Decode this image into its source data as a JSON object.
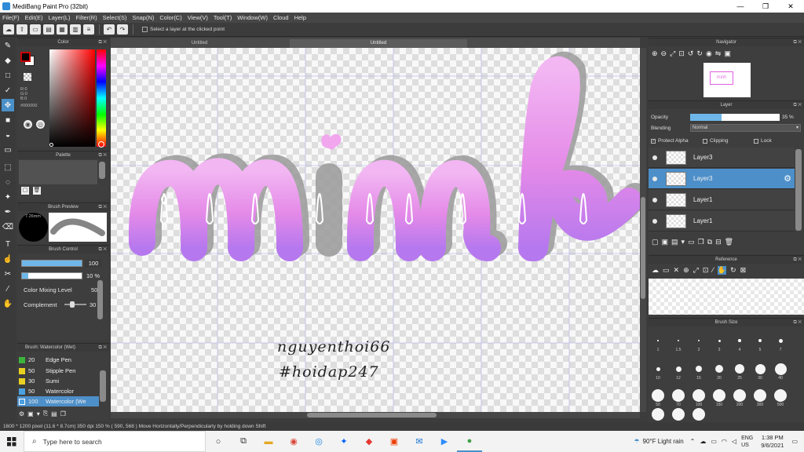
{
  "window": {
    "title": "MediBang Paint Pro (32bit)",
    "minimize": "—",
    "maximize": "❐",
    "close": "✕"
  },
  "menu": [
    "File(F)",
    "Edit(E)",
    "Layer(L)",
    "Filter(R)",
    "Select(S)",
    "Snap(N)",
    "Color(C)",
    "View(V)",
    "Tool(T)",
    "Window(W)",
    "Cloud",
    "Help"
  ],
  "toolbar": {
    "select_layer_label": "Select a layer at the clicked point"
  },
  "color_panel": {
    "title": "Color",
    "r": "R:0",
    "g": "G:0",
    "b": "B:0",
    "hex": "#000000",
    "primary_color": "#000000",
    "secondary_color": "#ffffff"
  },
  "palette_panel": {
    "title": "Palette"
  },
  "brush_preview": {
    "title": "Brush Preview",
    "size": "7.26mm"
  },
  "brush_control": {
    "title": "Brush Control",
    "size_value": "100",
    "opacity_value": "10 %",
    "mixing_label": "Color Mixing Level",
    "mixing_value": "50",
    "complement_label": "Complement",
    "complement_value": "30"
  },
  "brush_list": {
    "title": "Brush: Watercolor (Wet)",
    "items": [
      {
        "size": "20",
        "name": "Edge Pen",
        "color": "#3cb43c"
      },
      {
        "size": "50",
        "name": "Stipple Pen",
        "color": "#e8d020"
      },
      {
        "size": "30",
        "name": "Sumi",
        "color": "#e8d020"
      },
      {
        "size": "50",
        "name": "Watercolor",
        "color": "#4aa0e0"
      },
      {
        "size": "100",
        "name": "Watercolor (We",
        "color": "#4aa0e0"
      }
    ]
  },
  "tabs": {
    "tab1": "Untitled",
    "tab2": "Untitled"
  },
  "artwork": {
    "word": "minh",
    "signature_line1": "nguyenthoi66",
    "signature_line2": "#hoidap247"
  },
  "navigator": {
    "title": "Navigator",
    "thumb_text": "minh"
  },
  "layer_panel": {
    "title": "Layer",
    "opacity_label": "Opacity",
    "opacity_value": "35 %",
    "opacity_fraction": 0.35,
    "blending_label": "Blending",
    "blending_value": "Normal",
    "protect_alpha": "Protect Alpha",
    "clipping": "Clipping",
    "lock": "Lock",
    "layers": [
      {
        "name": "Layer3",
        "selected": false
      },
      {
        "name": "Layer3",
        "selected": true
      },
      {
        "name": "Layer1",
        "selected": false
      },
      {
        "name": "Layer1",
        "selected": false
      }
    ]
  },
  "reference": {
    "title": "Reference"
  },
  "brush_size": {
    "title": "Brush Size",
    "row1": [
      "1",
      "1.5",
      "2",
      "3",
      "4",
      "5",
      "7"
    ],
    "row2": [
      "10",
      "12",
      "15",
      "20",
      "25",
      "30",
      "40"
    ],
    "row3": [
      "50",
      "70",
      "100",
      "150",
      "200",
      "300",
      "500"
    ]
  },
  "status": {
    "text": "1600 * 1200 pixel   (11.6 * 8.7cm)   350 dpi   150 %   ( 590, 568 )   Move Horizontally/Perpendicularly by holding down Shift"
  },
  "taskbar": {
    "search_placeholder": "Type here to search",
    "weather": "90°F  Light rain",
    "lang1": "ENG",
    "lang2": "US",
    "time": "1:38 PM",
    "date": "9/6/2021"
  }
}
